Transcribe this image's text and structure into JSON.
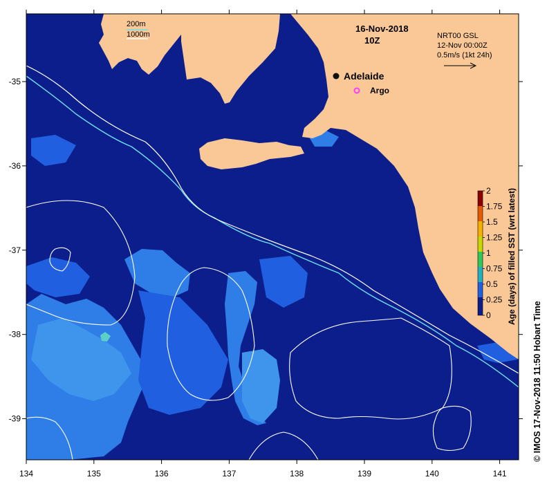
{
  "map": {
    "date": "16-Nov-2018",
    "time": "10Z",
    "cities": [
      {
        "label": "Adelaide"
      }
    ],
    "platforms": [
      {
        "label": "Argo"
      }
    ],
    "contour_legend": {
      "label_200": "200m",
      "label_1000": "1000m"
    },
    "current_legend": {
      "line1": "NRT00 GSL",
      "line2": "12-Nov 00:00Z",
      "line3": "0.5m/s (1kt 24h)"
    },
    "x_ticks": [
      "134",
      "135",
      "136",
      "137",
      "138",
      "139",
      "140",
      "141"
    ],
    "y_ticks": [
      "-35",
      "-36",
      "-37",
      "-38",
      "-39"
    ],
    "colorbar": {
      "title": "Age (days) of filled SST (wrt latest)",
      "ticks": [
        "2",
        "1.75",
        "1.5",
        "1.25",
        "1",
        "0.75",
        "0.5",
        "0.25",
        "0"
      ]
    },
    "credit": "© IMOS 17-Nov-2018 11:50 Hobart Time",
    "colors": {
      "ocean": "#0b1e8c",
      "land": "#f9c896",
      "age_half_day": "#1f5fe0",
      "age_low": "#2f7ee8",
      "age_mid": "#3f95ec",
      "contour_200": "#6ee0f0"
    }
  }
}
